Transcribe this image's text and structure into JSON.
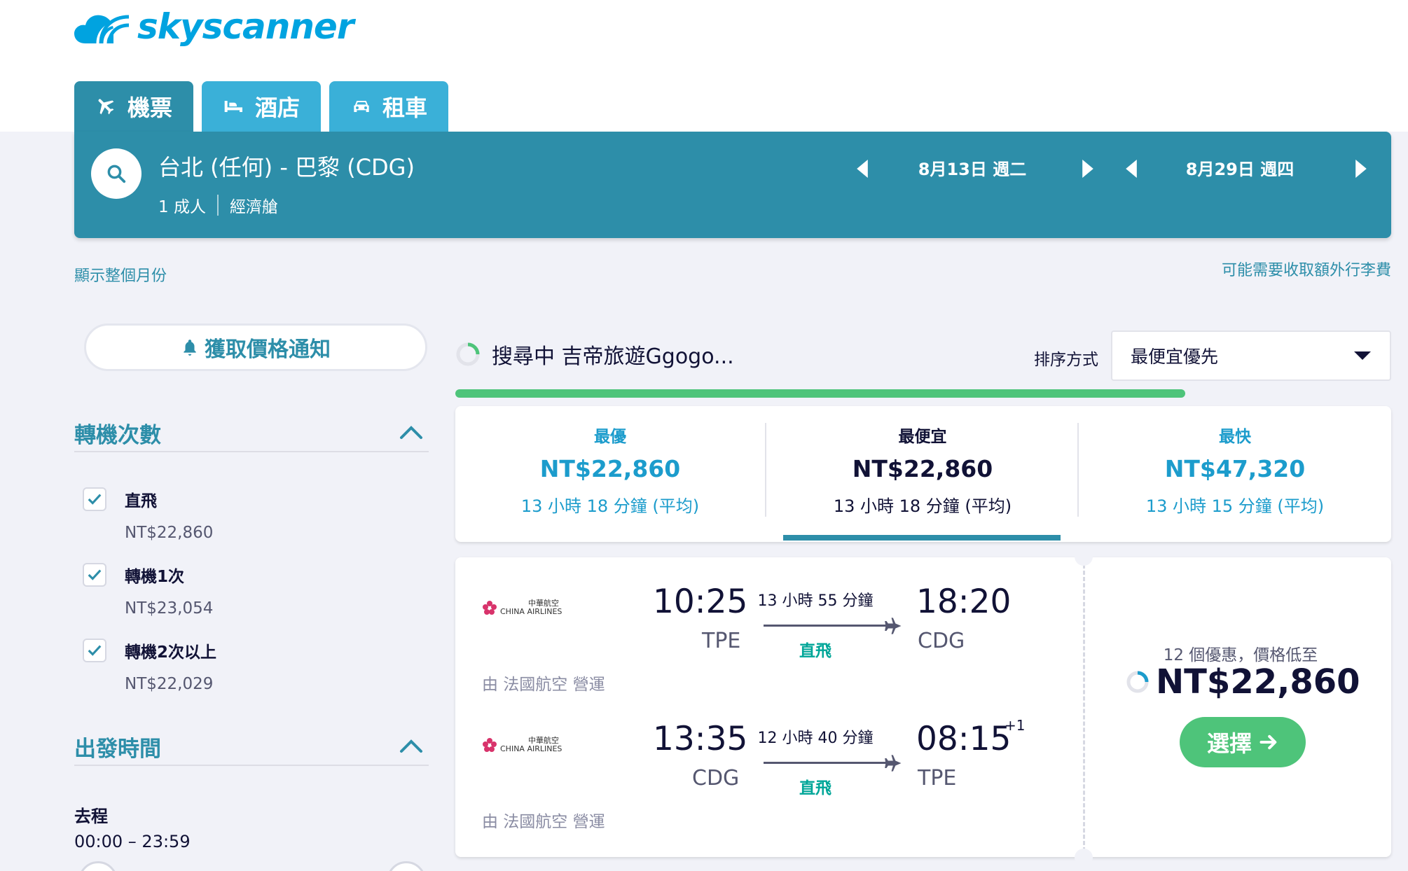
{
  "brand": {
    "name": "skyscanner"
  },
  "tabs": [
    {
      "label": "機票",
      "icon": "plane-icon",
      "active": true
    },
    {
      "label": "酒店",
      "icon": "bed-icon",
      "active": false
    },
    {
      "label": "租車",
      "icon": "car-icon",
      "active": false
    }
  ],
  "search": {
    "route": "台北 (任何) - 巴黎 (CDG)",
    "passengers": "1 成人",
    "cabin": "經濟艙",
    "outbound_date": "8月13日 週二",
    "return_date": "8月29日 週四"
  },
  "links": {
    "show_month": "顯示整個月份",
    "baggage_fee": "可能需要收取額外行李費"
  },
  "sidebar": {
    "price_alert": "獲取價格通知",
    "stops": {
      "title": "轉機次數",
      "options": [
        {
          "label": "直飛",
          "price": "NT$22,860",
          "checked": true
        },
        {
          "label": "轉機1次",
          "price": "NT$23,054",
          "checked": true
        },
        {
          "label": "轉機2次以上",
          "price": "NT$22,029",
          "checked": true
        }
      ]
    },
    "departure": {
      "title": "出發時間",
      "leg_label": "去程",
      "range": "00:00 – 23:59"
    }
  },
  "results": {
    "status": "搜尋中 吉帝旅遊Ggogo...",
    "sort_label": "排序方式",
    "sort_value": "最便宜優先",
    "progress": 0.78,
    "summary": [
      {
        "label": "最優",
        "price": "NT$22,860",
        "duration": "13 小時 18 分鐘 (平均)",
        "selected": false
      },
      {
        "label": "最便宜",
        "price": "NT$22,860",
        "duration": "13 小時 18 分鐘 (平均)",
        "selected": true
      },
      {
        "label": "最快",
        "price": "NT$47,320",
        "duration": "13 小時 15 分鐘 (平均)",
        "selected": false
      }
    ],
    "ticket": {
      "airline_logo_text": "CHINA AIRLINES",
      "airline_logo_chinese": "中華航空",
      "legs": [
        {
          "depart_time": "10:25",
          "depart_code": "TPE",
          "duration": "13 小時 55 分鐘",
          "stops": "直飛",
          "arrive_time": "18:20",
          "arrive_code": "CDG",
          "day_offset": "",
          "operated_by": "由 法國航空 營運"
        },
        {
          "depart_time": "13:35",
          "depart_code": "CDG",
          "duration": "12 小時 40 分鐘",
          "stops": "直飛",
          "arrive_time": "08:15",
          "arrive_code": "TPE",
          "day_offset": "+1",
          "operated_by": "由 法國航空 營運"
        }
      ],
      "deals_text": "12 個優惠，價格低至",
      "price": "NT$22,860",
      "select_label": "選擇"
    }
  },
  "colors": {
    "primary": "#2d8ea9",
    "tab": "#3ab0d8",
    "accent_green": "#4ec47a",
    "direct_green": "#00a698",
    "text_blue": "#1c9ccc"
  }
}
